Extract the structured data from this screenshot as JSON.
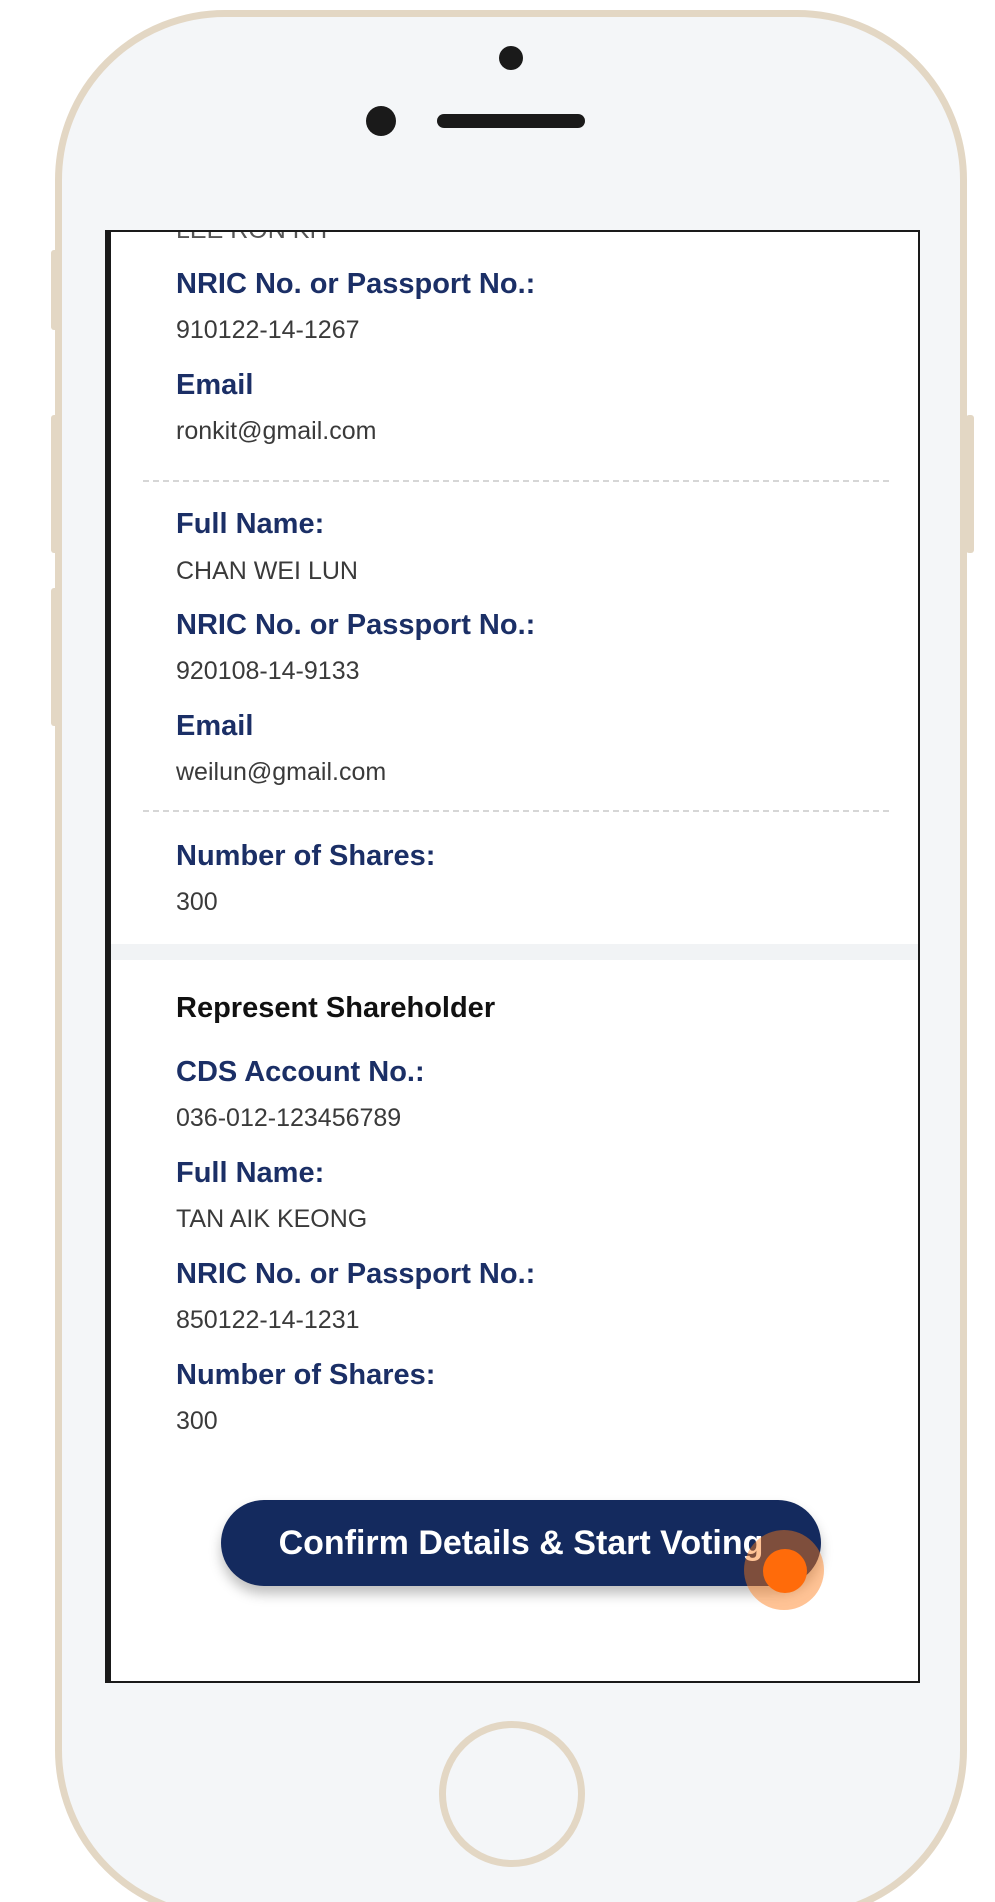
{
  "prev_record": {
    "cut_text": "LEE RON KIT",
    "nric_label": "NRIC No. or Passport No.:",
    "nric_value": "910122-14-1267",
    "email_label": "Email",
    "email_value": "ronkit@gmail.com"
  },
  "record2": {
    "name_label": "Full Name:",
    "name_value": "CHAN WEI LUN",
    "nric_label": "NRIC No. or Passport No.:",
    "nric_value": "920108-14-9133",
    "email_label": "Email",
    "email_value": "weilun@gmail.com"
  },
  "shares": {
    "label": "Number of Shares:",
    "value": "300"
  },
  "represent": {
    "heading": "Represent Shareholder",
    "cds_label": "CDS Account No.:",
    "cds_value": "036-012-123456789",
    "name_label": "Full Name:",
    "name_value": "TAN AIK KEONG",
    "nric_label": "NRIC No. or Passport No.:",
    "nric_value": "850122-14-1231",
    "shares_label": "Number of Shares:",
    "shares_value": "300"
  },
  "cta": {
    "label": "Confirm Details & Start Voting"
  },
  "colors": {
    "accent": "#142a5e",
    "label": "#1b2f66",
    "touch": "#ff6b0a",
    "frame": "#e3d7c4"
  }
}
